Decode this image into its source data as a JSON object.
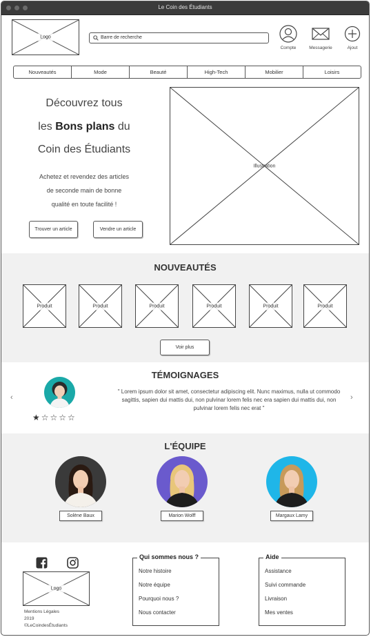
{
  "window": {
    "title": "Le Coin des Étudiants"
  },
  "header": {
    "logo": "Logo",
    "search_placeholder": "Barre de recherche",
    "icons": [
      {
        "label": "Compte",
        "icon": "user-icon"
      },
      {
        "label": "Messagerie",
        "icon": "mail-icon"
      },
      {
        "label": "Ajout",
        "icon": "plus-icon"
      }
    ]
  },
  "nav": [
    "Nouveautés",
    "Mode",
    "Beauté",
    "High-Tech",
    "Mobilier",
    "Loisirs"
  ],
  "hero": {
    "line1": "Découvrez tous",
    "line2_pre": "les ",
    "line2_bold": "Bons plans",
    "line2_post": " du",
    "line3": "Coin des Étudiants",
    "desc1": "Achetez et revendez des articles",
    "desc2": "de seconde main de bonne",
    "desc3": "qualité en toute facilité !",
    "btn_find": "Trouver un article",
    "btn_sell": "Vendre un article",
    "illustration": "Illustration"
  },
  "nouveautes": {
    "title": "NOUVEAUTÉS",
    "products": [
      "Produit",
      "Produit",
      "Produit",
      "Produit",
      "Produit",
      "Produit"
    ],
    "more": "Voir plus"
  },
  "temoignages": {
    "title": "TÉMOIGNAGES",
    "quote": "\" Lorem ipsum dolor sit amet, consectetur adipiscing elit. Nunc maximus, nulla ut commodo sagittis, sapien dui mattis dui, non pulvinar lorem felis nec era sapien dui mattis dui, non pulvinar lorem felis nec erat \"",
    "stars": "★☆☆☆☆",
    "rating": 1,
    "prev": "‹",
    "next": "›"
  },
  "equipe": {
    "title": "L'ÉQUIPE",
    "members": [
      "Solène Baux",
      "Marion Wolff",
      "Margaux Lamy"
    ],
    "colors": [
      "#3a3a3a",
      "#6a5acd",
      "#1fb6e8"
    ]
  },
  "footer": {
    "logo": "Logo",
    "legal": [
      "Mentions Légales",
      "2019",
      "©LeCoindesÉtudiants"
    ],
    "about": {
      "title": "Qui sommes nous ?",
      "links": [
        "Notre histoire",
        "Notre équipe",
        "Pourquoi nous ?",
        "Nous contacter"
      ]
    },
    "help": {
      "title": "Aide",
      "links": [
        "Assistance",
        "Suivi commande",
        "Livraison",
        "Mes ventes"
      ]
    }
  }
}
